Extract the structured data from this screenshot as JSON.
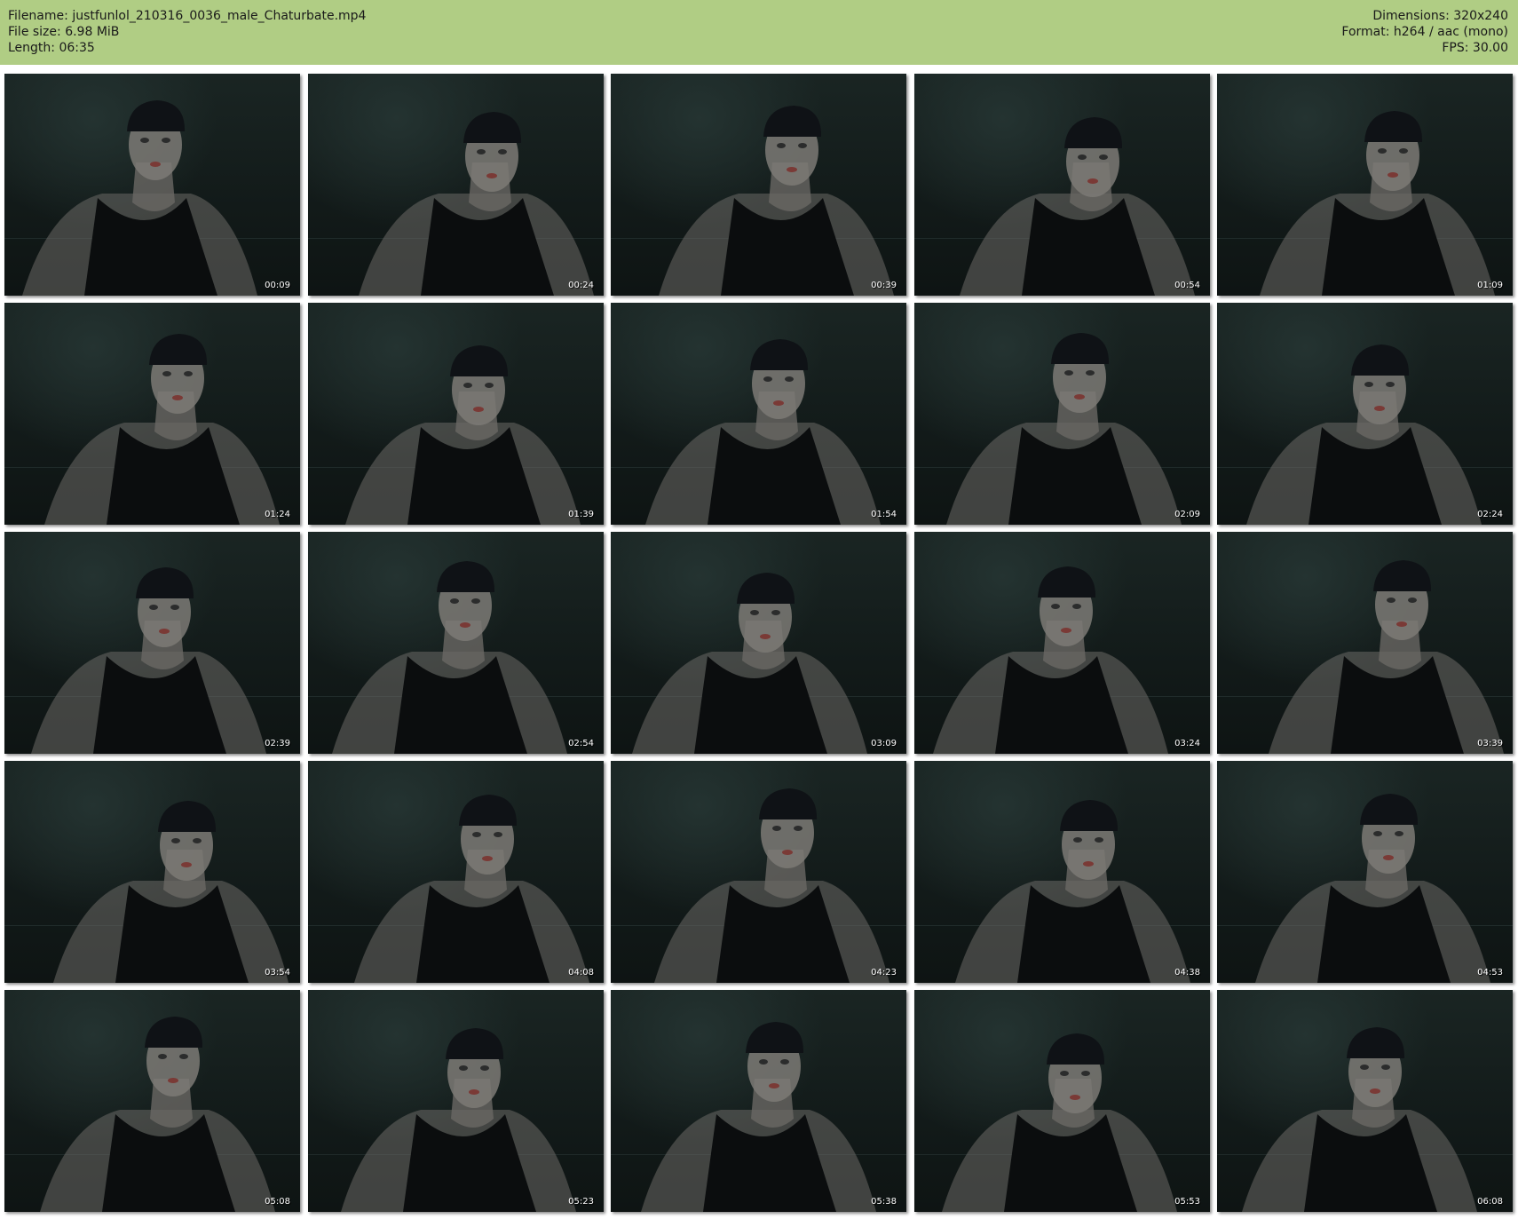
{
  "header": {
    "filename_label": "Filename:",
    "filename": "justfunlol_210316_0036_male_Chaturbate.mp4",
    "filesize_label": "File size:",
    "filesize": "6.98 MiB",
    "length_label": "Length:",
    "length": "06:35",
    "dimensions_label": "Dimensions:",
    "dimensions": "320x240",
    "format_label": "Format:",
    "format": "h264 / aac (mono)",
    "fps_label": "FPS:",
    "fps": "30.00"
  },
  "colors": {
    "header_bg": "#b0cd84",
    "page_bg": "#ffffff",
    "frame_bg": "#11181a",
    "watermark": "#7a1c1c",
    "timestamp": "#ffffff"
  },
  "thumbnails": [
    {
      "timestamp": "00:09"
    },
    {
      "timestamp": "00:24"
    },
    {
      "timestamp": "00:39"
    },
    {
      "timestamp": "00:54"
    },
    {
      "timestamp": "01:09"
    },
    {
      "timestamp": "01:24"
    },
    {
      "timestamp": "01:39"
    },
    {
      "timestamp": "01:54"
    },
    {
      "timestamp": "02:09"
    },
    {
      "timestamp": "02:24"
    },
    {
      "timestamp": "02:39"
    },
    {
      "timestamp": "02:54"
    },
    {
      "timestamp": "03:09"
    },
    {
      "timestamp": "03:24"
    },
    {
      "timestamp": "03:39"
    },
    {
      "timestamp": "03:54"
    },
    {
      "timestamp": "04:08"
    },
    {
      "timestamp": "04:23"
    },
    {
      "timestamp": "04:38"
    },
    {
      "timestamp": "04:53"
    },
    {
      "timestamp": "05:08"
    },
    {
      "timestamp": "05:23"
    },
    {
      "timestamp": "05:38"
    },
    {
      "timestamp": "05:53"
    },
    {
      "timestamp": "06:08"
    }
  ]
}
